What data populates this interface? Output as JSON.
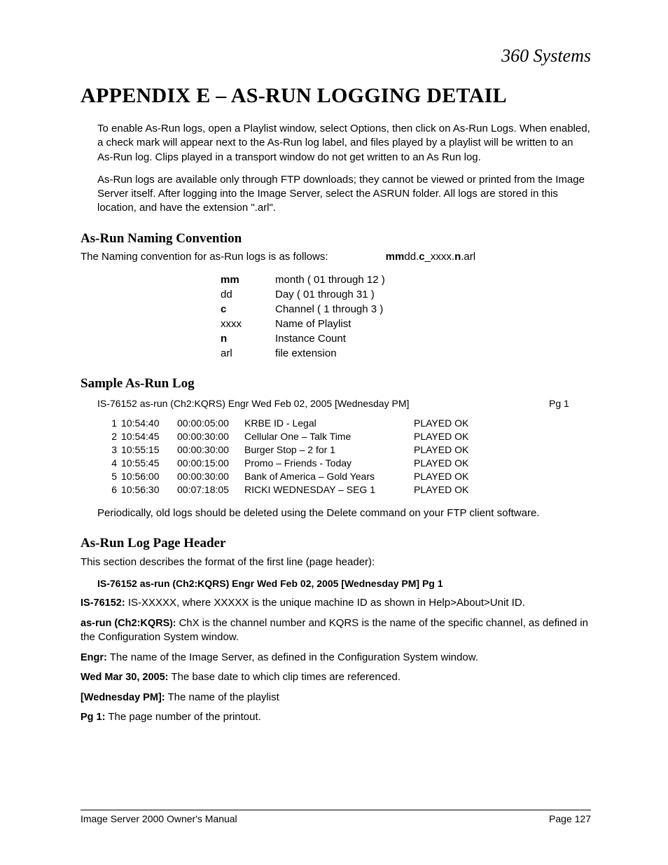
{
  "logo": "360 Systems",
  "title": "APPENDIX E – AS-RUN LOGGING DETAIL",
  "intro": {
    "p1": "To enable As-Run logs, open a Playlist window, select Options, then click on As-Run Logs. When enabled, a check mark will appear next to the As-Run log label, and files played by a playlist will be written to an As-Run log. Clips played in a transport window do not get written to an As Run log.",
    "p2": "As-Run logs are available only through FTP downloads; they cannot be viewed or printed from the Image Server itself.  After logging into the Image Server, select the ASRUN folder.  All logs are stored in this location, and have the extension \".arl\"."
  },
  "naming": {
    "heading": "As-Run Naming Convention",
    "line_prefix": "The Naming convention for as-Run logs is as follows:",
    "pattern": {
      "p1": "mm",
      "p2": "dd.",
      "p3": "c",
      "p4": "_xxxx.",
      "p5": "n",
      "p6": ".arl"
    },
    "rows": [
      {
        "key": "mm",
        "key_bold": true,
        "val": "month ( 01 through 12 )"
      },
      {
        "key": "dd",
        "key_bold": false,
        "val": "Day     ( 01 through 31 )"
      },
      {
        "key": "c",
        "key_bold": true,
        "val": "Channel ( 1 through 3 )"
      },
      {
        "key": "xxxx",
        "key_bold": false,
        "val": "Name of Playlist"
      },
      {
        "key": "n",
        "key_bold": true,
        "val": "Instance Count"
      },
      {
        "key": "arl",
        "key_bold": false,
        "val": "file extension"
      }
    ]
  },
  "sample": {
    "heading": "Sample As-Run Log",
    "header_main": "IS-76152 as-run (Ch2:KQRS) Engr Wed Feb 02, 2005 [Wednesday PM]",
    "header_pg": "Pg 1",
    "rows": [
      {
        "idx": "1",
        "start": "10:54:40",
        "dur": "00:00:05:00",
        "title": "KRBE ID - Legal",
        "status": "PLAYED OK"
      },
      {
        "idx": "2",
        "start": "10:54:45",
        "dur": "00:00:30:00",
        "title": "Cellular One – Talk Time",
        "status": "PLAYED OK"
      },
      {
        "idx": "3",
        "start": "10:55:15",
        "dur": "00:00:30:00",
        "title": "Burger Stop – 2 for 1",
        "status": "PLAYED OK"
      },
      {
        "idx": "4",
        "start": "10:55:45",
        "dur": "00:00:15:00",
        "title": "Promo – Friends - Today",
        "status": "PLAYED OK"
      },
      {
        "idx": "5",
        "start": "10:56:00",
        "dur": "00:00:30:00",
        "title": "Bank of America – Gold Years",
        "status": "PLAYED OK"
      },
      {
        "idx": "6",
        "start": "10:56:30",
        "dur": "00:07:18:05",
        "title": "RICKI WEDNESDAY – SEG 1",
        "status": "PLAYED OK"
      }
    ],
    "note": "Periodically, old logs should be deleted using the Delete command on your FTP client software."
  },
  "pageheader": {
    "heading": "As-Run Log Page Header",
    "intro": "This section describes the format of the first line (page header):",
    "bold_line": "IS-76152 as-run (Ch2:KQRS) Engr Wed Feb 02, 2005 [Wednesday PM]        Pg 1",
    "defs": [
      {
        "label": "IS-76152:",
        "text": "  IS-XXXXX, where XXXXX is the unique machine ID as shown in Help>About>Unit ID."
      },
      {
        "label": "as-run (Ch2:KQRS",
        "label_suffix": "):",
        "text": "  ChX is the channel number and KQRS is the name of the specific channel, as defined in the Configuration System window."
      },
      {
        "label": "Engr:",
        "text": "  The name of the Image Server, as defined in the Configuration System window."
      },
      {
        "label": "Wed Mar 30, 2005:",
        "text": "  The base date to which clip times are referenced."
      },
      {
        "label": "[Wednesday PM]:",
        "text": "  The name of the playlist"
      },
      {
        "label": "Pg 1:",
        "text": "  The page number of the printout."
      }
    ]
  },
  "footer": {
    "left": "Image Server 2000 Owner's Manual",
    "right": "Page 127"
  }
}
